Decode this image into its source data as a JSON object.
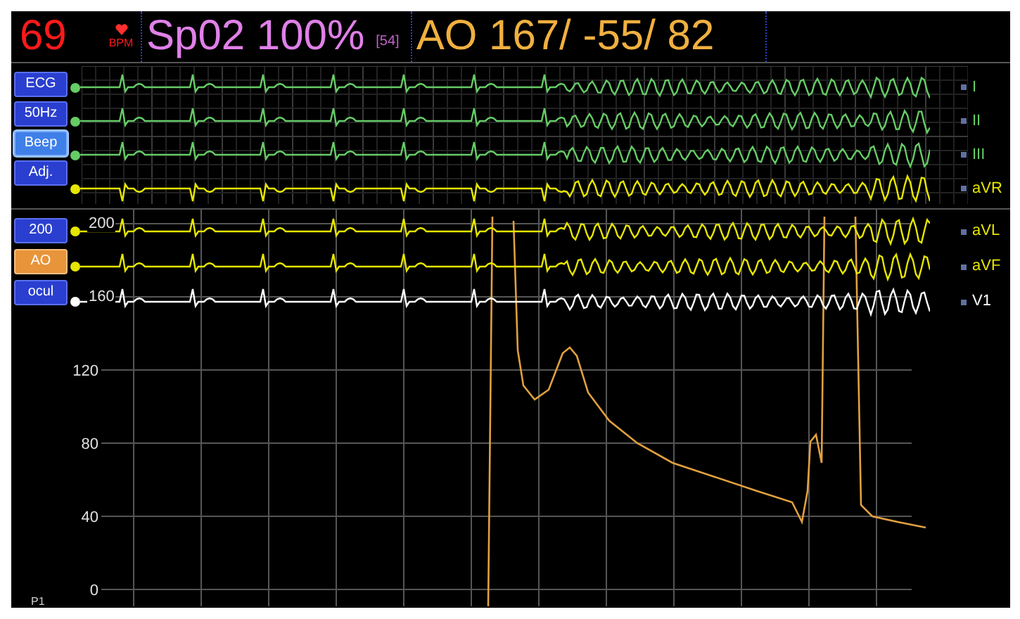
{
  "header": {
    "heart_rate": "69",
    "heart_rate_unit": "BPM",
    "spo2": "Sp02 100%",
    "spo2_pulse": "[54]",
    "ao_pressure": "AO 167/ -55/ 82"
  },
  "upper_buttons": [
    {
      "label": "ECG",
      "selected": false,
      "highlighted": false
    },
    {
      "label": "50Hz",
      "selected": false,
      "highlighted": false
    },
    {
      "label": "Beep",
      "selected": false,
      "highlighted": true
    },
    {
      "label": "Adj.",
      "selected": false,
      "highlighted": false
    }
  ],
  "upper_leads": [
    {
      "label": "I",
      "color": "#66cc66"
    },
    {
      "label": "II",
      "color": "#66cc66"
    },
    {
      "label": "III",
      "color": "#66cc66"
    },
    {
      "label": "aVR",
      "color": "#e6e600"
    }
  ],
  "lower_buttons": [
    {
      "label": "200",
      "selected": false,
      "highlighted": false
    },
    {
      "label": "AO",
      "selected": true,
      "highlighted": false
    },
    {
      "label": "ocul",
      "selected": false,
      "highlighted": false
    }
  ],
  "lower_leads": [
    {
      "label": "aVL",
      "color": "#e6e600"
    },
    {
      "label": "aVF",
      "color": "#e6e600"
    },
    {
      "label": "V1",
      "color": "#ffffff"
    }
  ],
  "pressure_scale": [
    "200",
    "160",
    "120",
    "80",
    "40",
    "0"
  ],
  "pressure_channel": "P1"
}
